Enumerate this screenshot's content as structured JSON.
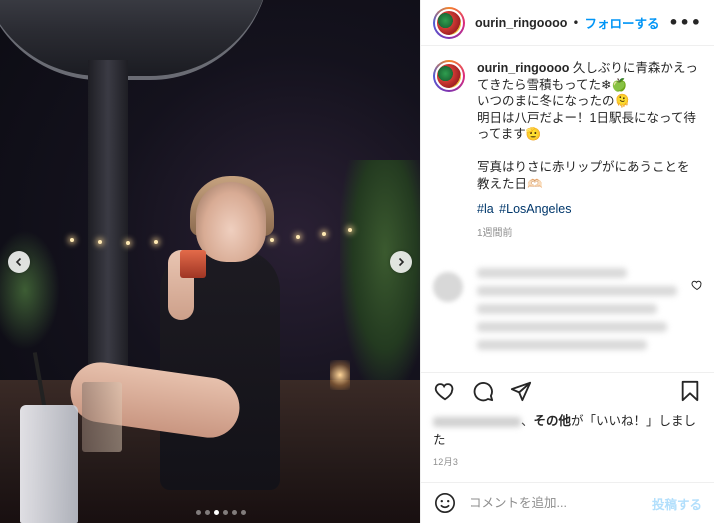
{
  "post": {
    "username": "ourin_ringoooo",
    "follow_label": "フォローする",
    "separator": "•",
    "more_label": "•••",
    "caption_body": "久しぶりに青森かえってきたら雪積もってた❄🍏\nいつのまに冬になったの🫠\n明日は八戸だよー！1日駅長になって待ってます🫡\n\n写真はりさに赤リップがにあうことを教えた日🫶🏻",
    "hashtags": [
      "#la",
      "#LosAngeles"
    ],
    "time_ago": "1週間前",
    "likes_suffix": "その他",
    "likes_text": "が「いいね！」しました",
    "date": "12月3",
    "comment_placeholder": "コメントを追加...",
    "post_button": "投稿する"
  },
  "carousel": {
    "total_slides": 6,
    "active_slide": 2
  },
  "icons": {
    "prev": "chevron-left-icon",
    "next": "chevron-right-icon",
    "like": "heart-icon",
    "comment": "comment-icon",
    "share": "share-icon",
    "save": "bookmark-icon",
    "emoji": "emoji-icon",
    "more": "more-icon"
  },
  "colors": {
    "accent": "#0095f6",
    "hashtag": "#00376b",
    "muted": "#8e8e8e",
    "post_disabled": "#b2dffc"
  }
}
